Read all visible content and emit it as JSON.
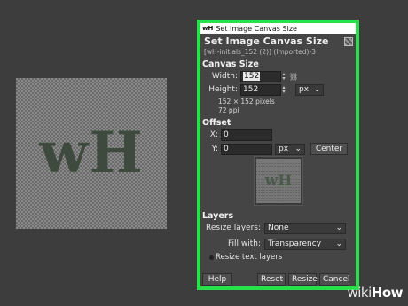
{
  "image_preview": {
    "logo_text": "wH"
  },
  "dialog": {
    "window_title": "Set Image Canvas Size",
    "window_icon": "wH",
    "heading": "Set Image Canvas Size",
    "subheading": "[wH-initials_152 (2)] (Imported)-3",
    "canvas_size": {
      "section_label": "Canvas Size",
      "width_label": "Width:",
      "width_value": "152",
      "height_label": "Height:",
      "height_value": "152",
      "unit": "px",
      "dimensions_info": "152 × 152 pixels",
      "resolution_info": "72 ppi"
    },
    "offset": {
      "section_label": "Offset",
      "x_label": "X:",
      "x_value": "0",
      "y_label": "Y:",
      "y_value": "0",
      "unit": "px",
      "center_label": "Center",
      "preview_logo": "wH"
    },
    "layers": {
      "section_label": "Layers",
      "resize_layers_label": "Resize layers:",
      "resize_layers_value": "None",
      "fill_with_label": "Fill with:",
      "fill_with_value": "Transparency",
      "resize_text_layers_label": "Resize text layers"
    },
    "buttons": {
      "help": "Help",
      "reset": "Reset",
      "resize": "Resize",
      "cancel": "Cancel"
    },
    "highlight_color": "#27e04a"
  },
  "watermark": {
    "wiki": "wiki",
    "how": "How"
  }
}
